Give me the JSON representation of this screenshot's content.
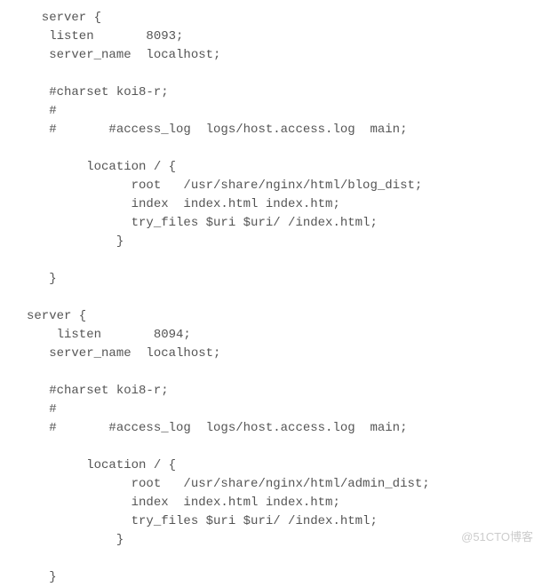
{
  "code": {
    "line01": "  server {",
    "line02": "   listen       8093;",
    "line03": "   server_name  localhost;",
    "line04": "",
    "line05": "   #charset koi8-r;",
    "line06": "   #",
    "line07": "   #       #access_log  logs/host.access.log  main;",
    "line08": "",
    "line09": "        location / {",
    "line10": "              root   /usr/share/nginx/html/blog_dist;",
    "line11": "              index  index.html index.htm;",
    "line12": "              try_files $uri $uri/ /index.html;",
    "line13": "            }",
    "line14": "",
    "line15": "   }",
    "line16": "",
    "line17": "server {",
    "line18": "    listen       8094;",
    "line19": "   server_name  localhost;",
    "line20": "",
    "line21": "   #charset koi8-r;",
    "line22": "   #",
    "line23": "   #       #access_log  logs/host.access.log  main;",
    "line24": "",
    "line25": "        location / {",
    "line26": "              root   /usr/share/nginx/html/admin_dist;",
    "line27": "              index  index.html index.htm;",
    "line28": "              try_files $uri $uri/ /index.html;",
    "line29": "            }",
    "line30": "",
    "line31": "   }"
  },
  "watermark": "@51CTO博客"
}
